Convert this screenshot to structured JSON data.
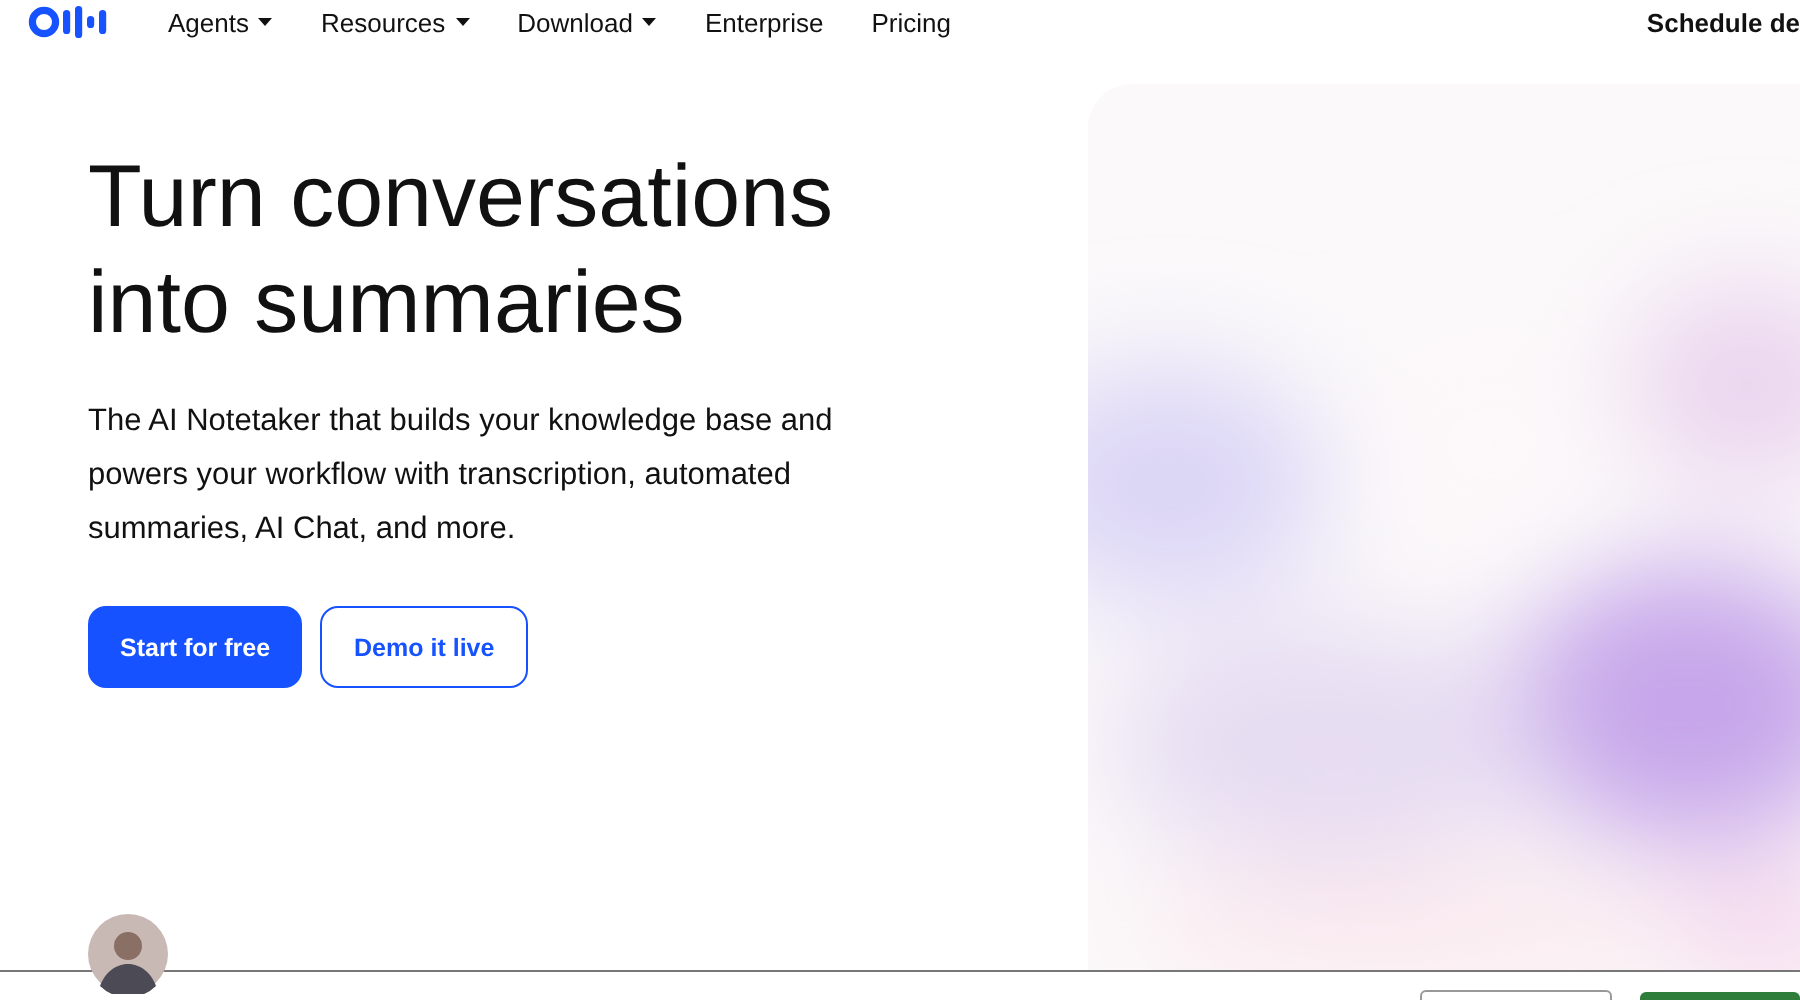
{
  "nav": {
    "items": [
      {
        "label": "Agents",
        "has_menu": true
      },
      {
        "label": "Resources",
        "has_menu": true
      },
      {
        "label": "Download",
        "has_menu": true
      },
      {
        "label": "Enterprise",
        "has_menu": false
      },
      {
        "label": "Pricing",
        "has_menu": false
      }
    ],
    "action": "Schedule de"
  },
  "hero": {
    "heading": "Turn conversations into summaries",
    "text": "The AI Notetaker that builds your knowledge base and powers your workflow with transcription, automated summaries, AI Chat, and more.",
    "buttons": [
      {
        "label": "Start for free",
        "kind": "primary"
      },
      {
        "label": "Demo it live",
        "kind": "secondary"
      }
    ]
  },
  "footer_bar": {
    "buttons": [
      {
        "kind": "secondary"
      },
      {
        "kind": "primary"
      }
    ]
  }
}
